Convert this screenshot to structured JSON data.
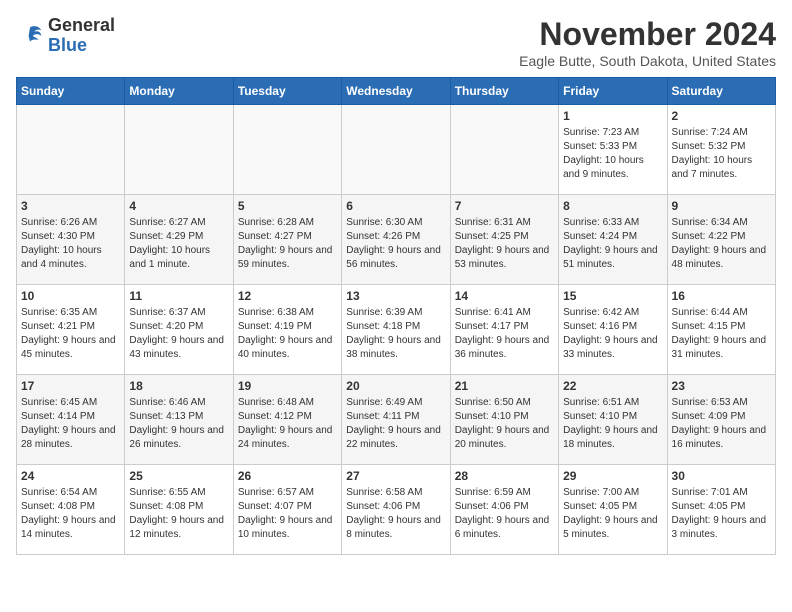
{
  "header": {
    "logo_general": "General",
    "logo_blue": "Blue",
    "month_year": "November 2024",
    "location": "Eagle Butte, South Dakota, United States"
  },
  "weekdays": [
    "Sunday",
    "Monday",
    "Tuesday",
    "Wednesday",
    "Thursday",
    "Friday",
    "Saturday"
  ],
  "weeks": [
    [
      {
        "day": "",
        "info": ""
      },
      {
        "day": "",
        "info": ""
      },
      {
        "day": "",
        "info": ""
      },
      {
        "day": "",
        "info": ""
      },
      {
        "day": "",
        "info": ""
      },
      {
        "day": "1",
        "info": "Sunrise: 7:23 AM\nSunset: 5:33 PM\nDaylight: 10 hours and 9 minutes."
      },
      {
        "day": "2",
        "info": "Sunrise: 7:24 AM\nSunset: 5:32 PM\nDaylight: 10 hours and 7 minutes."
      }
    ],
    [
      {
        "day": "3",
        "info": "Sunrise: 6:26 AM\nSunset: 4:30 PM\nDaylight: 10 hours and 4 minutes."
      },
      {
        "day": "4",
        "info": "Sunrise: 6:27 AM\nSunset: 4:29 PM\nDaylight: 10 hours and 1 minute."
      },
      {
        "day": "5",
        "info": "Sunrise: 6:28 AM\nSunset: 4:27 PM\nDaylight: 9 hours and 59 minutes."
      },
      {
        "day": "6",
        "info": "Sunrise: 6:30 AM\nSunset: 4:26 PM\nDaylight: 9 hours and 56 minutes."
      },
      {
        "day": "7",
        "info": "Sunrise: 6:31 AM\nSunset: 4:25 PM\nDaylight: 9 hours and 53 minutes."
      },
      {
        "day": "8",
        "info": "Sunrise: 6:33 AM\nSunset: 4:24 PM\nDaylight: 9 hours and 51 minutes."
      },
      {
        "day": "9",
        "info": "Sunrise: 6:34 AM\nSunset: 4:22 PM\nDaylight: 9 hours and 48 minutes."
      }
    ],
    [
      {
        "day": "10",
        "info": "Sunrise: 6:35 AM\nSunset: 4:21 PM\nDaylight: 9 hours and 45 minutes."
      },
      {
        "day": "11",
        "info": "Sunrise: 6:37 AM\nSunset: 4:20 PM\nDaylight: 9 hours and 43 minutes."
      },
      {
        "day": "12",
        "info": "Sunrise: 6:38 AM\nSunset: 4:19 PM\nDaylight: 9 hours and 40 minutes."
      },
      {
        "day": "13",
        "info": "Sunrise: 6:39 AM\nSunset: 4:18 PM\nDaylight: 9 hours and 38 minutes."
      },
      {
        "day": "14",
        "info": "Sunrise: 6:41 AM\nSunset: 4:17 PM\nDaylight: 9 hours and 36 minutes."
      },
      {
        "day": "15",
        "info": "Sunrise: 6:42 AM\nSunset: 4:16 PM\nDaylight: 9 hours and 33 minutes."
      },
      {
        "day": "16",
        "info": "Sunrise: 6:44 AM\nSunset: 4:15 PM\nDaylight: 9 hours and 31 minutes."
      }
    ],
    [
      {
        "day": "17",
        "info": "Sunrise: 6:45 AM\nSunset: 4:14 PM\nDaylight: 9 hours and 28 minutes."
      },
      {
        "day": "18",
        "info": "Sunrise: 6:46 AM\nSunset: 4:13 PM\nDaylight: 9 hours and 26 minutes."
      },
      {
        "day": "19",
        "info": "Sunrise: 6:48 AM\nSunset: 4:12 PM\nDaylight: 9 hours and 24 minutes."
      },
      {
        "day": "20",
        "info": "Sunrise: 6:49 AM\nSunset: 4:11 PM\nDaylight: 9 hours and 22 minutes."
      },
      {
        "day": "21",
        "info": "Sunrise: 6:50 AM\nSunset: 4:10 PM\nDaylight: 9 hours and 20 minutes."
      },
      {
        "day": "22",
        "info": "Sunrise: 6:51 AM\nSunset: 4:10 PM\nDaylight: 9 hours and 18 minutes."
      },
      {
        "day": "23",
        "info": "Sunrise: 6:53 AM\nSunset: 4:09 PM\nDaylight: 9 hours and 16 minutes."
      }
    ],
    [
      {
        "day": "24",
        "info": "Sunrise: 6:54 AM\nSunset: 4:08 PM\nDaylight: 9 hours and 14 minutes."
      },
      {
        "day": "25",
        "info": "Sunrise: 6:55 AM\nSunset: 4:08 PM\nDaylight: 9 hours and 12 minutes."
      },
      {
        "day": "26",
        "info": "Sunrise: 6:57 AM\nSunset: 4:07 PM\nDaylight: 9 hours and 10 minutes."
      },
      {
        "day": "27",
        "info": "Sunrise: 6:58 AM\nSunset: 4:06 PM\nDaylight: 9 hours and 8 minutes."
      },
      {
        "day": "28",
        "info": "Sunrise: 6:59 AM\nSunset: 4:06 PM\nDaylight: 9 hours and 6 minutes."
      },
      {
        "day": "29",
        "info": "Sunrise: 7:00 AM\nSunset: 4:05 PM\nDaylight: 9 hours and 5 minutes."
      },
      {
        "day": "30",
        "info": "Sunrise: 7:01 AM\nSunset: 4:05 PM\nDaylight: 9 hours and 3 minutes."
      }
    ]
  ]
}
